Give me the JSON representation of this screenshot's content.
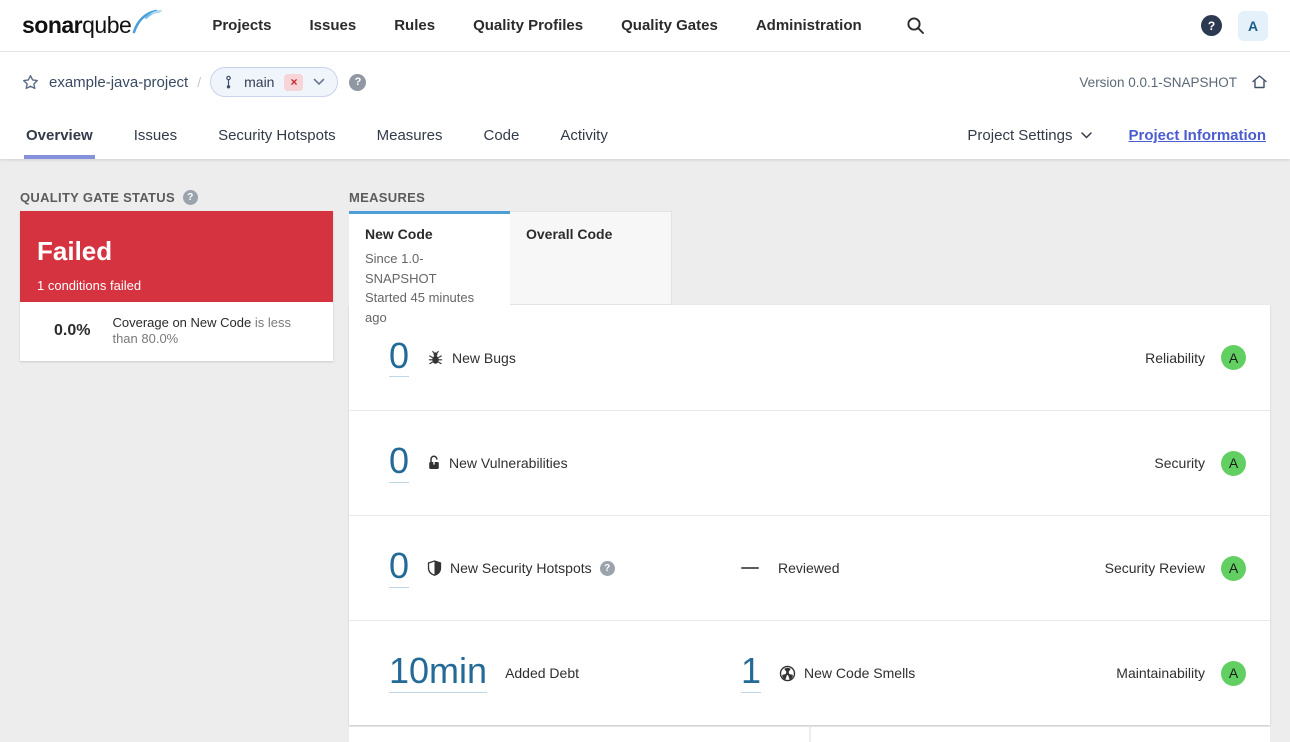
{
  "nav": {
    "logo_bold": "sonar",
    "logo_light": "qube",
    "items": [
      "Projects",
      "Issues",
      "Rules",
      "Quality Profiles",
      "Quality Gates",
      "Administration"
    ],
    "help_glyph": "?",
    "avatar": "A"
  },
  "breadcrumb": {
    "project": "example-java-project",
    "separator": "/",
    "branch": "main",
    "close_glyph": "×",
    "help_glyph": "?",
    "version": "Version 0.0.1-SNAPSHOT"
  },
  "tabs": {
    "items": [
      "Overview",
      "Issues",
      "Security Hotspots",
      "Measures",
      "Code",
      "Activity"
    ],
    "active": "Overview",
    "settings": "Project Settings",
    "information": "Project Information"
  },
  "quality_gate": {
    "title": "QUALITY GATE STATUS",
    "help_glyph": "?",
    "status": "Failed",
    "subtitle": "1 conditions failed",
    "condition_value": "0.0%",
    "condition_metric": "Coverage on New Code",
    "condition_rest": "is less than 80.0%"
  },
  "measures": {
    "title": "MEASURES",
    "new_code_tab": {
      "label": "New Code",
      "since": "Since 1.0-SNAPSHOT",
      "started": "Started 45 minutes ago"
    },
    "overall_tab": {
      "label": "Overall Code"
    },
    "rows": [
      {
        "value": "0",
        "label": "New Bugs",
        "domain": "Reliability",
        "rating": "A"
      },
      {
        "value": "0",
        "label": "New Vulnerabilities",
        "domain": "Security",
        "rating": "A"
      },
      {
        "value": "0",
        "label": "New Security Hotspots",
        "help_glyph": "?",
        "reviewed_dash": "—",
        "reviewed_label": "Reviewed",
        "domain": "Security Review",
        "rating": "A"
      },
      {
        "value": "10min",
        "label": "Added Debt",
        "value2": "1",
        "label2": "New Code Smells",
        "domain": "Maintainability",
        "rating": "A"
      }
    ]
  },
  "colors": {
    "link_blue": "#236a97",
    "rating_green": "#62cf62",
    "failed_red": "#d4333f",
    "active_tab_underline": "#8591db",
    "new_code_tab_border": "#4b9fd5"
  }
}
